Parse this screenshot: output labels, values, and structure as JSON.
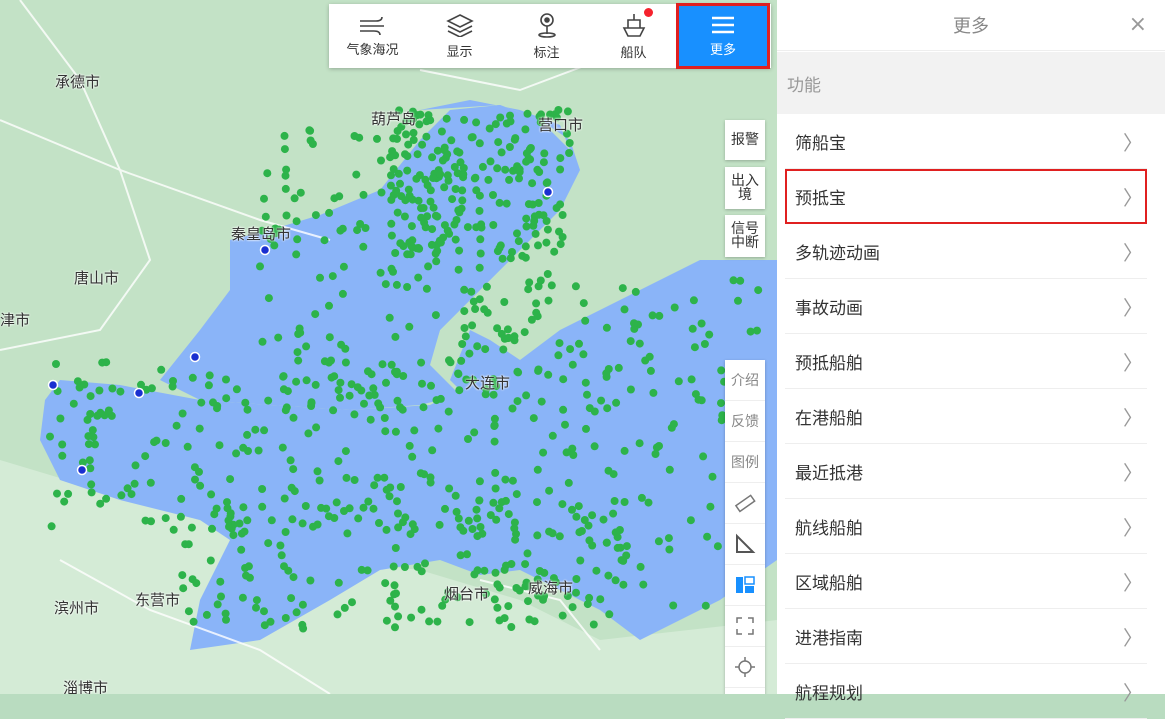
{
  "toolbar": [
    {
      "label": "气象海况",
      "icon": "wind-icon"
    },
    {
      "label": "显示",
      "icon": "layers-icon"
    },
    {
      "label": "标注",
      "icon": "pin-icon"
    },
    {
      "label": "船队",
      "icon": "ship-icon"
    },
    {
      "label": "更多",
      "icon": "menu-icon"
    }
  ],
  "map_side": {
    "alarm": "报警",
    "inout": "出入境",
    "signal": "信号中断"
  },
  "map_tools": {
    "intro": "介绍",
    "feedback": "反馈",
    "legend": "图例"
  },
  "cities": [
    "承德市",
    "葫芦岛",
    "营口市",
    "秦皇岛市",
    "唐山市",
    "津市",
    "大连市",
    "东营市",
    "滨州市",
    "烟台市",
    "威海市",
    "淄博市"
  ],
  "panel": {
    "title": "更多",
    "close": "×",
    "section": "功能",
    "items": [
      "筛船宝",
      "预抵宝",
      "多轨迹动画",
      "事故动画",
      "预抵船舶",
      "在港船舶",
      "最近抵港",
      "航线船舶",
      "区域船舶",
      "进港指南",
      "航程规划"
    ]
  },
  "colors": {
    "accent": "#1890ff",
    "highlight": "#e02020",
    "ship": "#2db34a",
    "sea": "#8ab4f8",
    "land": "#b9dcc0"
  }
}
